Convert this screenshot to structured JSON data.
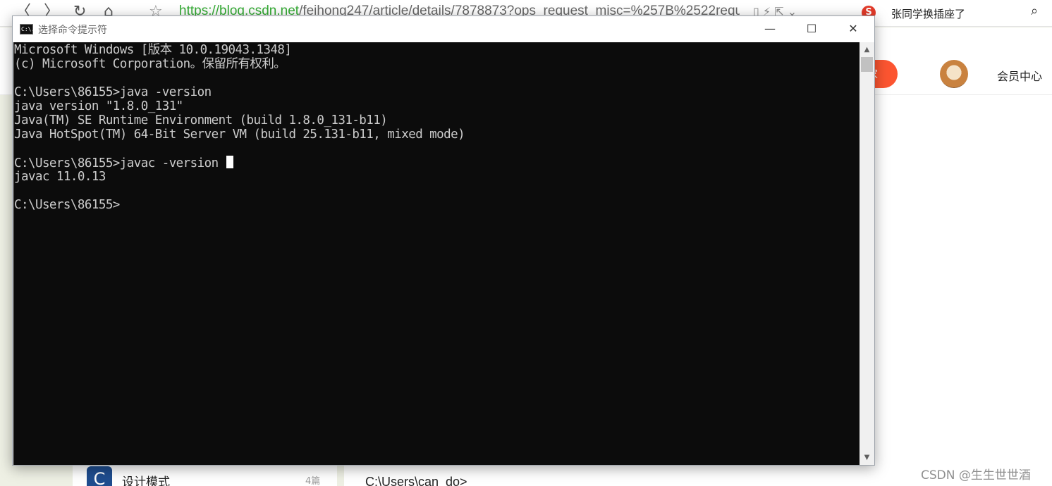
{
  "browser": {
    "back_icon": "〈",
    "forward_icon": "〉",
    "reload_icon": "↻",
    "home_icon": "⌂",
    "star_icon": "☆",
    "url_host": "https://blog.csdn.net",
    "url_path": "/feihong247/article/details/7878873?ops_request_misc=%257B%2522requ",
    "search_engine_letter": "S",
    "search_hint": "张同学换插座了"
  },
  "site": {
    "header_button_label": "家",
    "member_center_label": "会员中心",
    "column_name": "设计模式",
    "column_count": "4篇",
    "column_icon_letter": "C",
    "article_line": "C:\\Users\\can_do>",
    "watermark": "CSDN @生生世世酒"
  },
  "cmd": {
    "title": "选择命令提示符",
    "app_icon_text": "C:\\.",
    "minimize_icon": "—",
    "maximize_icon": "☐",
    "close_icon": "✕",
    "scroll_up_icon": "▲",
    "scroll_down_icon": "▼",
    "lines": [
      "Microsoft Windows [版本 10.0.19043.1348]",
      "(c) Microsoft Corporation。保留所有权利。",
      "",
      "C:\\Users\\86155>java -version",
      "java version \"1.8.0_131\"",
      "Java(TM) SE Runtime Environment (build 1.8.0_131-b11)",
      "Java HotSpot(TM) 64-Bit Server VM (build 25.131-b11, mixed mode)",
      "",
      "C:\\Users\\86155>javac -version ",
      "javac 11.0.13",
      "",
      "C:\\Users\\86155>"
    ],
    "cursor_line": 8
  }
}
